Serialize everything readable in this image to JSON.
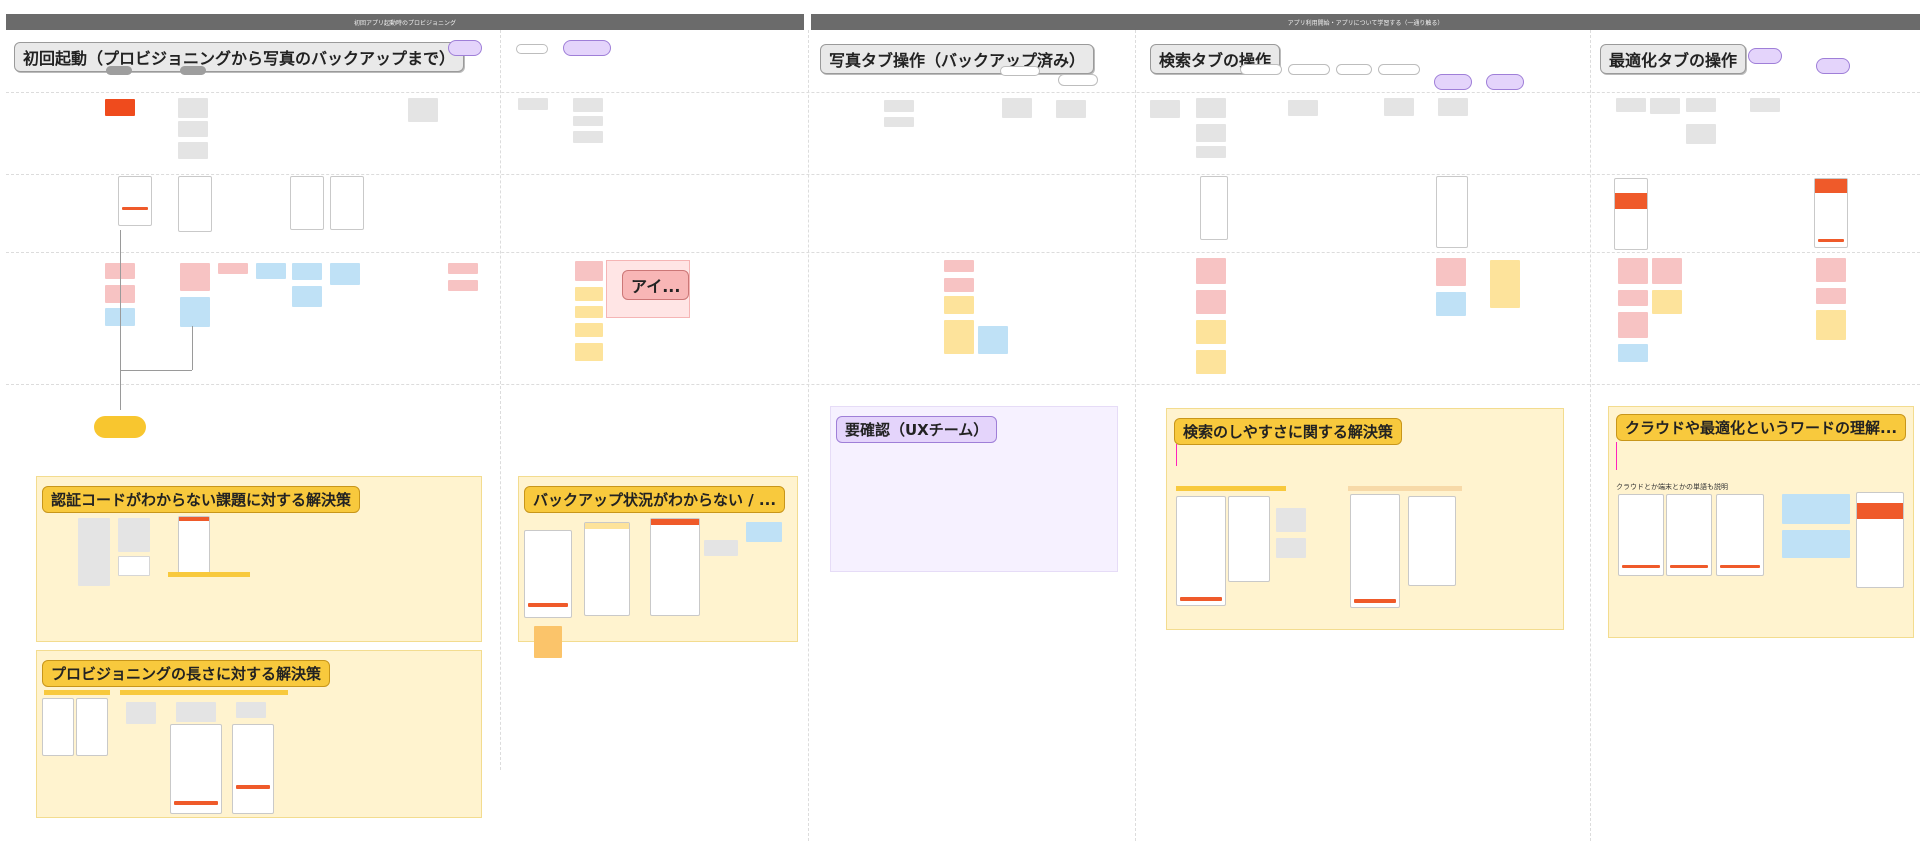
{
  "bands": {
    "left": "初回アプリ起動時のプロビジョニング",
    "right": "アプリ利用開始・アプリについて学習する（一通り触る）"
  },
  "sections": {
    "first_launch": "初回起動（プロビジョニングから写真のバックアップまで）",
    "photo_tab": "写真タブ操作（バックアップ済み）",
    "search_tab": "検索タブの操作",
    "optimize_tab": "最適化タブの操作"
  },
  "solutions": {
    "auth_code": "認証コードがわからない課題に対する解決策",
    "provisioning_length": "プロビジョニングの長さに対する解決策",
    "backup_status": "バックアップ状況がわからない / ...",
    "search_ease": "検索のしやすさに関する解決策",
    "cloud_words": "クラウドや最適化というワードの理解..."
  },
  "confirm": {
    "title": "要確認（UXチーム）"
  },
  "popup": {
    "title": "アイ..."
  },
  "cloud_section": {
    "caption": "クラウドとか端末とかの単語も説明"
  },
  "colors": {
    "band": "#6b6b6b",
    "sticky_gray": "#e4e4e4",
    "sticky_red": "#f7c3c3",
    "sticky_blue": "#bfe1f6",
    "sticky_yellow": "#fde39b",
    "accent_orange": "#ef5a2a",
    "solution_bg": "#fff3cf",
    "solution_title": "#f8c93d",
    "confirm_bg": "#f6f1ff",
    "purple": "#e4d4fb"
  }
}
